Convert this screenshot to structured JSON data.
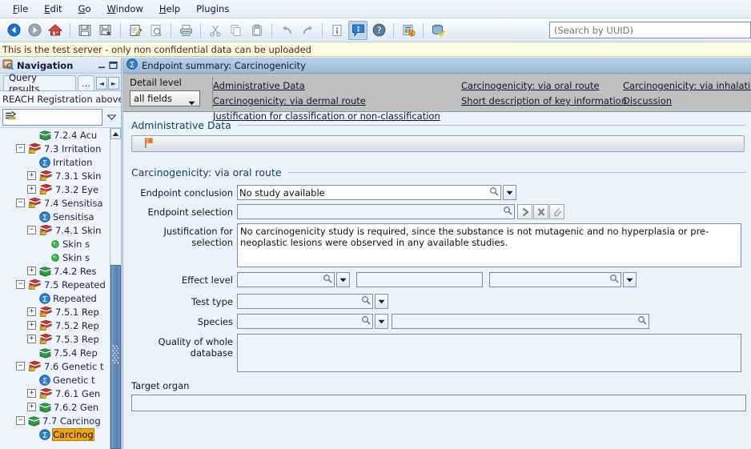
{
  "menubar": {
    "items": [
      {
        "label": "File",
        "mnemonic": "F"
      },
      {
        "label": "Edit",
        "mnemonic": "E"
      },
      {
        "label": "Go",
        "mnemonic": "G"
      },
      {
        "label": "Window",
        "mnemonic": "W"
      },
      {
        "label": "Help",
        "mnemonic": "H"
      },
      {
        "label": "Plugins",
        "mnemonic": ""
      }
    ]
  },
  "toolbar": {
    "buttons": [
      {
        "name": "back-icon"
      },
      {
        "name": "forward-icon"
      },
      {
        "name": "home-icon"
      },
      {
        "name": "save-icon"
      },
      {
        "name": "save-as-icon"
      },
      {
        "name": "edit-icon"
      },
      {
        "name": "preview-icon"
      },
      {
        "name": "print-icon"
      },
      {
        "name": "cut-icon"
      },
      {
        "name": "copy-icon"
      },
      {
        "name": "paste-icon"
      },
      {
        "name": "undo-icon"
      },
      {
        "name": "redo-icon"
      },
      {
        "name": "document-info-icon"
      },
      {
        "name": "info-balloon-icon"
      },
      {
        "name": "help-icon"
      },
      {
        "name": "report-icon"
      },
      {
        "name": "validate-database-icon"
      }
    ],
    "search": {
      "value": "",
      "placeholder": "(Search by UUID)"
    }
  },
  "warning": {
    "text": "This is the test server - only non confidential data can be uploaded"
  },
  "navigation": {
    "title": "Navigation",
    "window_buttons": [
      "minimize",
      "maximize"
    ],
    "tabs": [
      {
        "label": "Query results",
        "active": true
      },
      {
        "label": "...",
        "active": false
      }
    ],
    "tab_nav": [
      "◄",
      "►"
    ],
    "subtitle": "REACH Registration above",
    "filter": {
      "value": "",
      "placeholder": ""
    },
    "tree": [
      {
        "indent": 3,
        "expander": "none",
        "icon": "green-book",
        "label": "7.2.4 Acu",
        "italic": false,
        "selected": false
      },
      {
        "indent": 2,
        "expander": "minus",
        "icon": "red-book",
        "label": "7.3 Irritation",
        "italic": false,
        "selected": false
      },
      {
        "indent": 3,
        "expander": "none",
        "icon": "blue-sigma",
        "label": "Irritation",
        "italic": true,
        "selected": false
      },
      {
        "indent": 3,
        "expander": "plus",
        "icon": "red-book",
        "label": "7.3.1 Skin",
        "italic": false,
        "selected": false
      },
      {
        "indent": 3,
        "expander": "plus",
        "icon": "red-book",
        "label": "7.3.2 Eye",
        "italic": false,
        "selected": false
      },
      {
        "indent": 2,
        "expander": "minus",
        "icon": "red-book",
        "label": "7.4 Sensitisa",
        "italic": false,
        "selected": false
      },
      {
        "indent": 3,
        "expander": "none",
        "icon": "blue-sigma",
        "label": "Sensitisa",
        "italic": true,
        "selected": false
      },
      {
        "indent": 3,
        "expander": "minus",
        "icon": "red-book",
        "label": "7.4.1 Skin",
        "italic": false,
        "selected": false
      },
      {
        "indent": 4,
        "expander": "none",
        "icon": "green-dot",
        "label": "Skin s",
        "italic": true,
        "selected": false
      },
      {
        "indent": 4,
        "expander": "none",
        "icon": "green-dot",
        "label": "Skin s",
        "italic": true,
        "selected": false
      },
      {
        "indent": 3,
        "expander": "plus",
        "icon": "green-book",
        "label": "7.4.2 Res",
        "italic": false,
        "selected": false
      },
      {
        "indent": 2,
        "expander": "minus",
        "icon": "red-book",
        "label": "7.5 Repeated",
        "italic": false,
        "selected": false
      },
      {
        "indent": 3,
        "expander": "none",
        "icon": "blue-sigma",
        "label": "Repeated",
        "italic": true,
        "selected": false
      },
      {
        "indent": 3,
        "expander": "plus",
        "icon": "red-book",
        "label": "7.5.1 Rep",
        "italic": false,
        "selected": false
      },
      {
        "indent": 3,
        "expander": "plus",
        "icon": "red-book",
        "label": "7.5.2 Rep",
        "italic": false,
        "selected": false
      },
      {
        "indent": 3,
        "expander": "plus",
        "icon": "red-book",
        "label": "7.5.3 Rep",
        "italic": false,
        "selected": false
      },
      {
        "indent": 3,
        "expander": "none",
        "icon": "green-book",
        "label": "7.5.4 Rep",
        "italic": false,
        "selected": false
      },
      {
        "indent": 2,
        "expander": "minus",
        "icon": "red-book",
        "label": "7.6 Genetic t",
        "italic": false,
        "selected": false
      },
      {
        "indent": 3,
        "expander": "none",
        "icon": "blue-sigma",
        "label": "Genetic t",
        "italic": true,
        "selected": false
      },
      {
        "indent": 3,
        "expander": "plus",
        "icon": "red-book",
        "label": "7.6.1 Gen",
        "italic": false,
        "selected": false
      },
      {
        "indent": 3,
        "expander": "plus",
        "icon": "green-book",
        "label": "7.6.2 Gen",
        "italic": false,
        "selected": false
      },
      {
        "indent": 2,
        "expander": "minus",
        "icon": "green-book",
        "label": "7.7 Carcinog",
        "italic": false,
        "selected": false
      },
      {
        "indent": 3,
        "expander": "none",
        "icon": "blue-sigma",
        "label": "Carcinog",
        "italic": true,
        "selected": true
      }
    ]
  },
  "editor": {
    "title": "Endpoint summary: Carcinogenicity",
    "detail_level": {
      "label": "Detail level",
      "value": "all fields"
    },
    "links": [
      {
        "label": "Administrative Data",
        "col": 0,
        "row": 0
      },
      {
        "label": "Carcinogenicity: via oral route",
        "col": 1,
        "row": 0
      },
      {
        "label": "Carcinogenicity: via inhalation route",
        "col": 2,
        "row": 0
      },
      {
        "label": "Carcinogenicity: via dermal route",
        "col": 0,
        "row": 1
      },
      {
        "label": "Short description of key information",
        "col": 1,
        "row": 1
      },
      {
        "label": "Discussion",
        "col": 2,
        "row": 1
      },
      {
        "label": "Justification for classification or non-classification",
        "col": 0,
        "row": 2
      }
    ],
    "sections": [
      {
        "name": "administrative-data",
        "title": "Administrative Data"
      },
      {
        "name": "carcinogenicity-via-oral-route",
        "title": "Carcinogenicity: via oral route"
      }
    ],
    "flagbar": {
      "icon": "orange-flag",
      "value": ""
    },
    "fields": {
      "endpoint_conclusion": {
        "label": "Endpoint conclusion",
        "value": "No study available"
      },
      "endpoint_selection": {
        "label": "Endpoint selection",
        "value": ""
      },
      "justification_for_selection": {
        "label": "Justification for selection",
        "value": "No carcinogenicity study is required, since the substance is not mutagenic and no hyperplasia or pre-neoplastic lesions were observed in any available studies."
      },
      "effect_level": {
        "label": "Effect level",
        "value_1": "",
        "value_2": "",
        "value_3": ""
      },
      "test_type": {
        "label": "Test type",
        "value": ""
      },
      "species": {
        "label": "Species",
        "value_1": "",
        "value_2": ""
      },
      "quality_of_whole_database": {
        "label": "Quality of whole database",
        "value": ""
      },
      "target_organ": {
        "label": "Target organ",
        "value": ""
      }
    }
  },
  "colors": {
    "accent": "#1f3c64",
    "warning_bg": "#fbfbe0",
    "warning_text": "#6b1a1a",
    "selection": "#f3a415",
    "navbar_bg": "#bfbfbf",
    "panel_bg": "#eaf2fb"
  }
}
